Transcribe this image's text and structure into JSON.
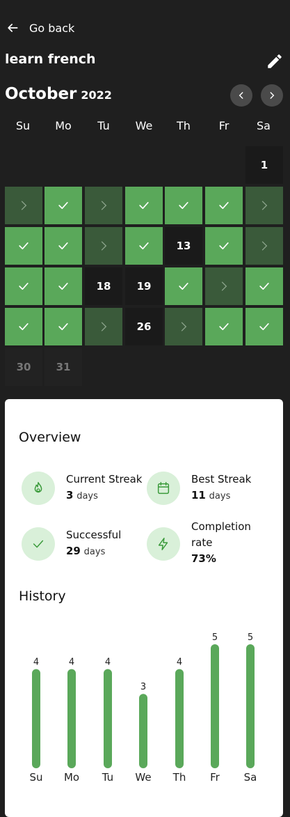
{
  "nav": {
    "back_label": "Go back"
  },
  "habit": {
    "title": "learn french"
  },
  "calendar": {
    "month": "October",
    "year": "2022",
    "weekdays": [
      "Su",
      "Mo",
      "Tu",
      "We",
      "Th",
      "Fr",
      "Sa"
    ],
    "days": {
      "d1": "1",
      "d13": "13",
      "d18": "18",
      "d19": "19",
      "d26": "26",
      "d30": "30",
      "d31": "31"
    }
  },
  "overview": {
    "title": "Overview",
    "current_streak": {
      "label": "Current Streak",
      "value": "3",
      "unit": "days"
    },
    "best_streak": {
      "label": "Best Streak",
      "value": "11",
      "unit": "days"
    },
    "successful": {
      "label": "Successful",
      "value": "29",
      "unit": "days"
    },
    "completion": {
      "label_line1": "Completion",
      "label_line2": "rate",
      "value": "73%"
    }
  },
  "history": {
    "title": "History"
  },
  "chart_data": {
    "type": "bar",
    "categories": [
      "Su",
      "Mo",
      "Tu",
      "We",
      "Th",
      "Fr",
      "Sa"
    ],
    "values": [
      4,
      4,
      4,
      3,
      4,
      5,
      5
    ],
    "ylim": [
      0,
      5
    ]
  }
}
